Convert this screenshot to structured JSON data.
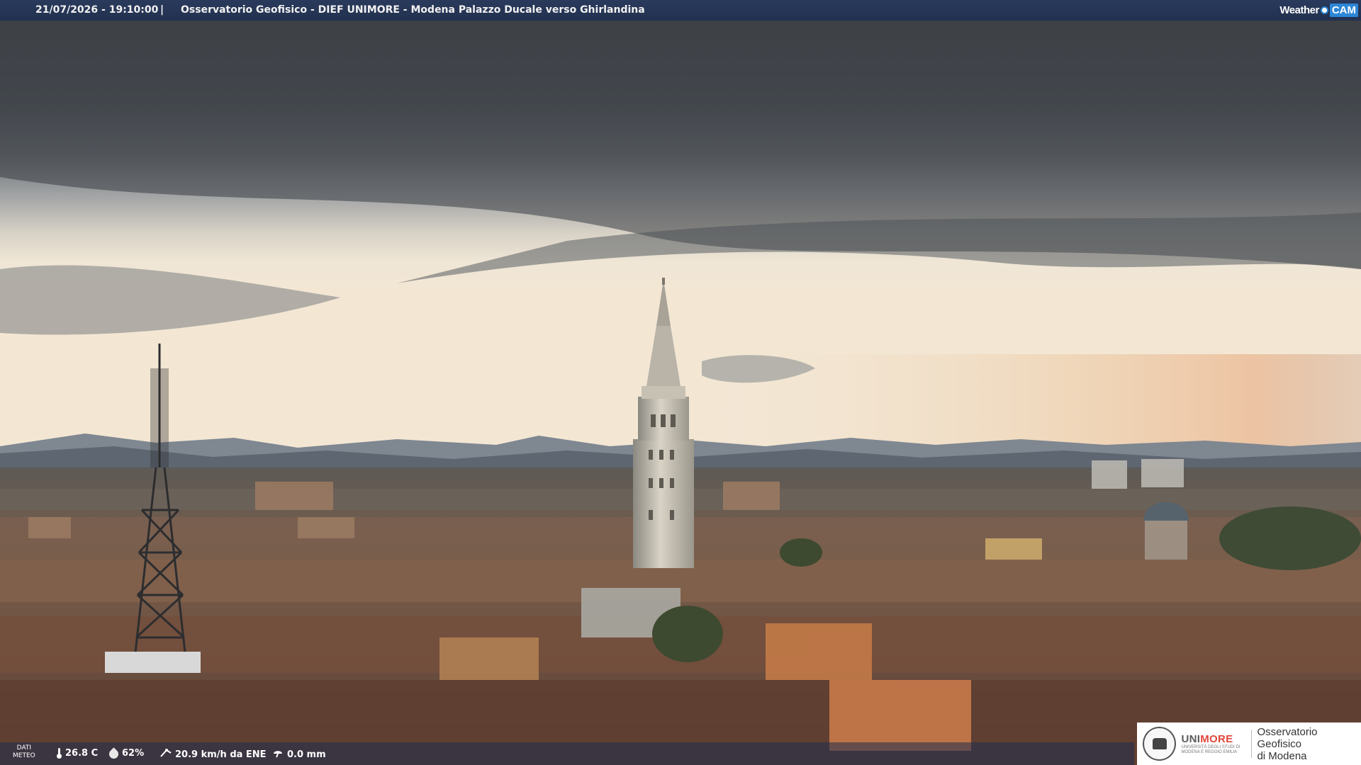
{
  "header": {
    "timestamp": "21/07/2026 - 19:10:00",
    "separator": "|",
    "title": "Osservatorio Geofisico - DIEF UNIMORE - Modena Palazzo Ducale verso Ghirlandina"
  },
  "brand": {
    "weather": "Weather",
    "cam": "CAM"
  },
  "meteo": {
    "label_line1": "DATI",
    "label_line2": "METEO",
    "temperature": "26.8 C",
    "humidity": "62%",
    "wind": "20.9 km/h da ENE",
    "rain": "0.0 mm"
  },
  "logo": {
    "uni_part1": "UNI",
    "uni_part2": "MORE",
    "uni_sub": "UNIVERSITÀ DEGLI STUDI DI MODENA E REGGIO EMILIA",
    "obs_line1": "Osservatorio Geofisico",
    "obs_line2": "di Modena"
  },
  "colors": {
    "header_bg": "#22314f",
    "accent_blue": "#2d86d6",
    "unimore_red": "#e0463a"
  }
}
